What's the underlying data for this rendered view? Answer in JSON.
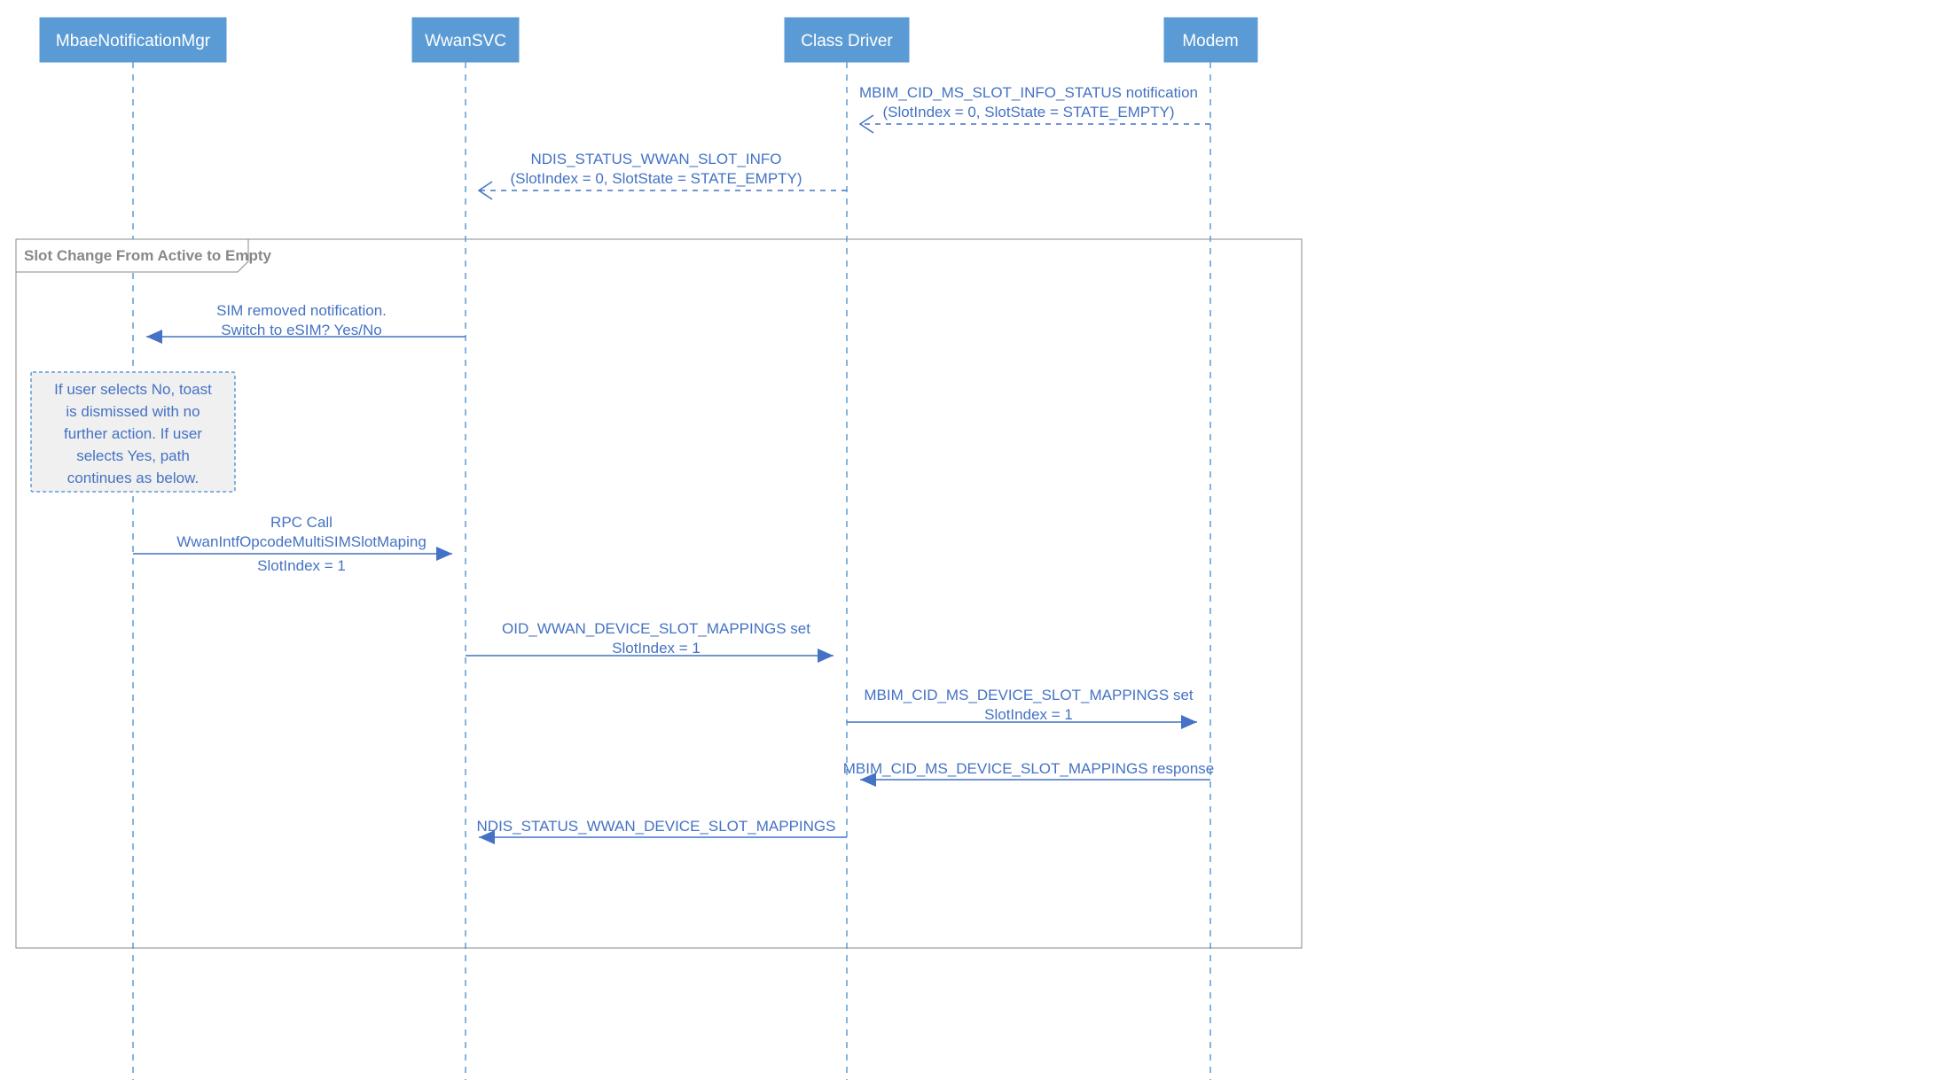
{
  "actors": {
    "mbae": "MbaeNotificationMgr",
    "wwan": "WwanSVC",
    "driver": "Class Driver",
    "modem": "Modem"
  },
  "frame_label": "Slot Change From Active to Empty",
  "messages": {
    "m1_l1": "MBIM_CID_MS_SLOT_INFO_STATUS notification",
    "m1_l2": "(SlotIndex = 0, SlotState = STATE_EMPTY)",
    "m2_l1": "NDIS_STATUS_WWAN_SLOT_INFO",
    "m2_l2": "(SlotIndex = 0, SlotState = STATE_EMPTY)",
    "m3_l1": "SIM removed notification.",
    "m3_l2": "Switch to eSIM? Yes/No",
    "m4_l1": "RPC Call",
    "m4_l2": "WwanIntfOpcodeMultiSIMSlotMaping",
    "m4_l3": "SlotIndex = 1",
    "m5_l1": "OID_WWAN_DEVICE_SLOT_MAPPINGS set",
    "m5_l2": "SlotIndex = 1",
    "m6_l1": "MBIM_CID_MS_DEVICE_SLOT_MAPPINGS set",
    "m6_l2": "SlotIndex = 1",
    "m7": "MBIM_CID_MS_DEVICE_SLOT_MAPPINGS response",
    "m8": "NDIS_STATUS_WWAN_DEVICE_SLOT_MAPPINGS"
  },
  "note": {
    "l1": "If user selects No, toast",
    "l2": "is dismissed with no",
    "l3": "further action. If user",
    "l4": "selects Yes, path",
    "l5": "continues as below."
  }
}
